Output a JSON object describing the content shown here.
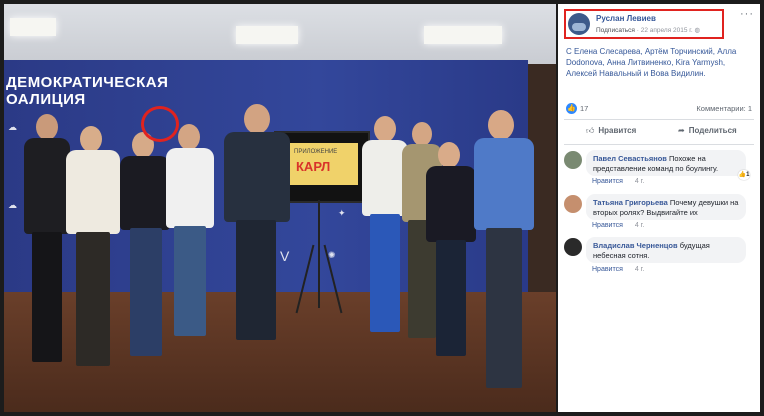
{
  "photo": {
    "banner_title_1": "ДЕМОКРАТИЧЕСКАЯ",
    "banner_title_2": "ОАЛИЦИЯ",
    "screen_small": "ПРИЛОЖЕНИЕ",
    "screen_big": "КАРЛ"
  },
  "post": {
    "author": "Руслан Левиев",
    "subscribe": "Подписаться",
    "date": "22 апреля 2015 г.",
    "more": "···",
    "tags": "С Елена Слесарева, Артём Торчинский, Алла Dodonova, Анна Литвиненко, Kira Yarmysh, Алексей Навальный и Вова Видилин.",
    "like_count": "17",
    "comments_count": "Комментарии: 1",
    "like_label": "Нравится",
    "share_label": "Поделиться"
  },
  "comments": [
    {
      "name": "Павел Севастьянов",
      "text": "Похоже на представление команд по боулингу.",
      "reply": "Нравится",
      "time": "4 г.",
      "reactions": "1"
    },
    {
      "name": "Татьяна Григорьева",
      "text": "Почему девушки на вторых ролях? Выдвигайте их",
      "reply": "Нравится",
      "time": "4 г."
    },
    {
      "name": "Владислав Черненцов",
      "text": "будущая небесная сотня.",
      "reply": "Нравится",
      "time": "4 г."
    }
  ],
  "colors": {
    "link": "#365899",
    "highlight": "#e0231f",
    "banner": "#33479b"
  }
}
